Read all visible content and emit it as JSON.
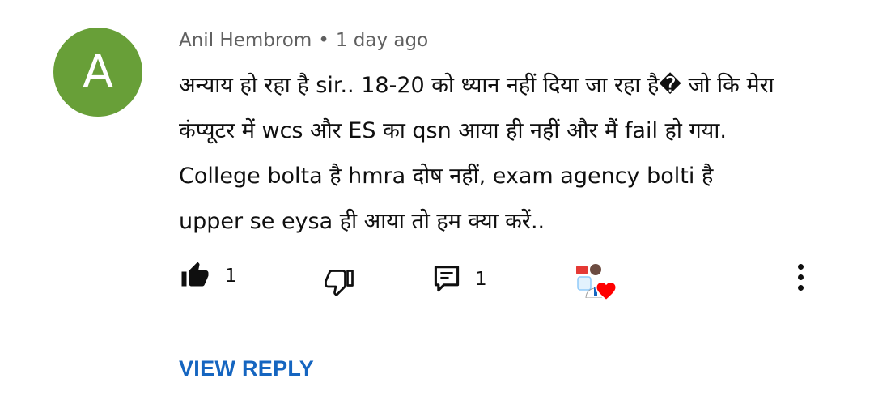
{
  "comment": {
    "avatar_letter": "A",
    "avatar_color": "#689f38",
    "author": "Anil Hembrom",
    "separator": "•",
    "timestamp": "1 day ago",
    "text": "अन्याय हो रहा है sir.. 18-20 को ध्यान नहीं दिया जा रहा है� जो कि मेरा कंप्यूटर में wcs और ES का qsn आया ही नहीं और मैं fail हो गया. College bolta है hmra दोष नहीं, exam agency bolti है upper se eysa ही आया तो हम क्या करें..",
    "like_count": "1",
    "reply_count": "1",
    "icons": {
      "like": "thumbs-up-icon",
      "dislike": "thumbs-down-icon",
      "reply": "comment-icon",
      "hearted": "creator-heart-icon",
      "more": "more-vertical-icon"
    },
    "view_reply_label": "VIEW REPLY",
    "link_color": "#1565c0"
  }
}
